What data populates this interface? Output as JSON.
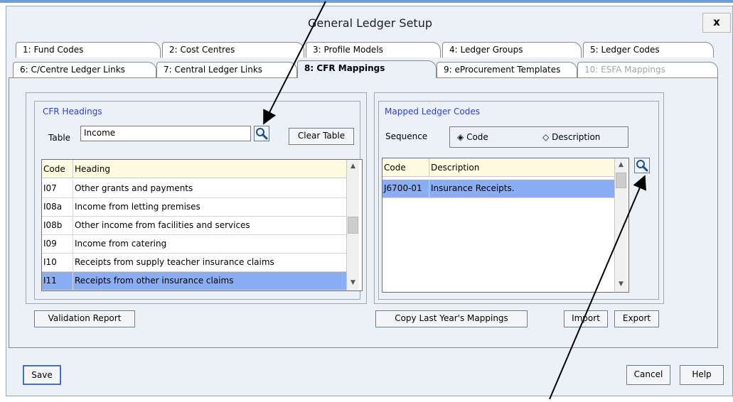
{
  "window": {
    "title": "General Ledger Setup",
    "close": "x"
  },
  "tabs_row1": [
    {
      "label": "1: Fund Codes"
    },
    {
      "label": "2: Cost Centres"
    },
    {
      "label": "3: Profile Models"
    },
    {
      "label": "4: Ledger Groups"
    },
    {
      "label": "5: Ledger Codes"
    }
  ],
  "tabs_row2": [
    {
      "label": "6: C/Centre Ledger Links"
    },
    {
      "label": "7: Central Ledger Links"
    },
    {
      "label": "8: CFR Mappings"
    },
    {
      "label": "9: eProcurement Templates"
    },
    {
      "label": "10: ESFA Mappings"
    }
  ],
  "cfr": {
    "title": "CFR Headings",
    "table_label": "Table",
    "table_value": "Income",
    "clear_label": "Clear Table",
    "columns": [
      "Code",
      "Heading"
    ],
    "rows": [
      {
        "code": "I07",
        "heading": "Other grants and payments"
      },
      {
        "code": "I08a",
        "heading": "Income from letting premises"
      },
      {
        "code": "I08b",
        "heading": "Other income from facilities and services"
      },
      {
        "code": "I09",
        "heading": "Income from catering"
      },
      {
        "code": "I10",
        "heading": "Receipts from supply teacher insurance claims"
      },
      {
        "code": "I11",
        "heading": "Receipts from other insurance claims"
      }
    ],
    "selected_row": 5
  },
  "mapped": {
    "title": "Mapped Ledger Codes",
    "sequence_label": "Sequence",
    "option_code": "Code",
    "option_desc": "Description",
    "selected_option": "Code",
    "columns": [
      "Code",
      "Description"
    ],
    "rows": [
      {
        "code": "J6700-01",
        "description": "Insurance Receipts."
      }
    ]
  },
  "buttons": {
    "validation": "Validation Report",
    "copy": "Copy Last Year's Mappings",
    "import": "Import",
    "export": "Export",
    "save": "Save",
    "cancel": "Cancel",
    "help": "Help"
  },
  "icons": {
    "search": "magnifier-icon",
    "radio_on": "◈",
    "radio_off": "◇",
    "up": "▲",
    "down": "▼"
  },
  "colors": {
    "selection": "#8aaef5",
    "header": "#fffbe0",
    "group_title": "#2a3ed8",
    "window": "#ecf1f8"
  }
}
